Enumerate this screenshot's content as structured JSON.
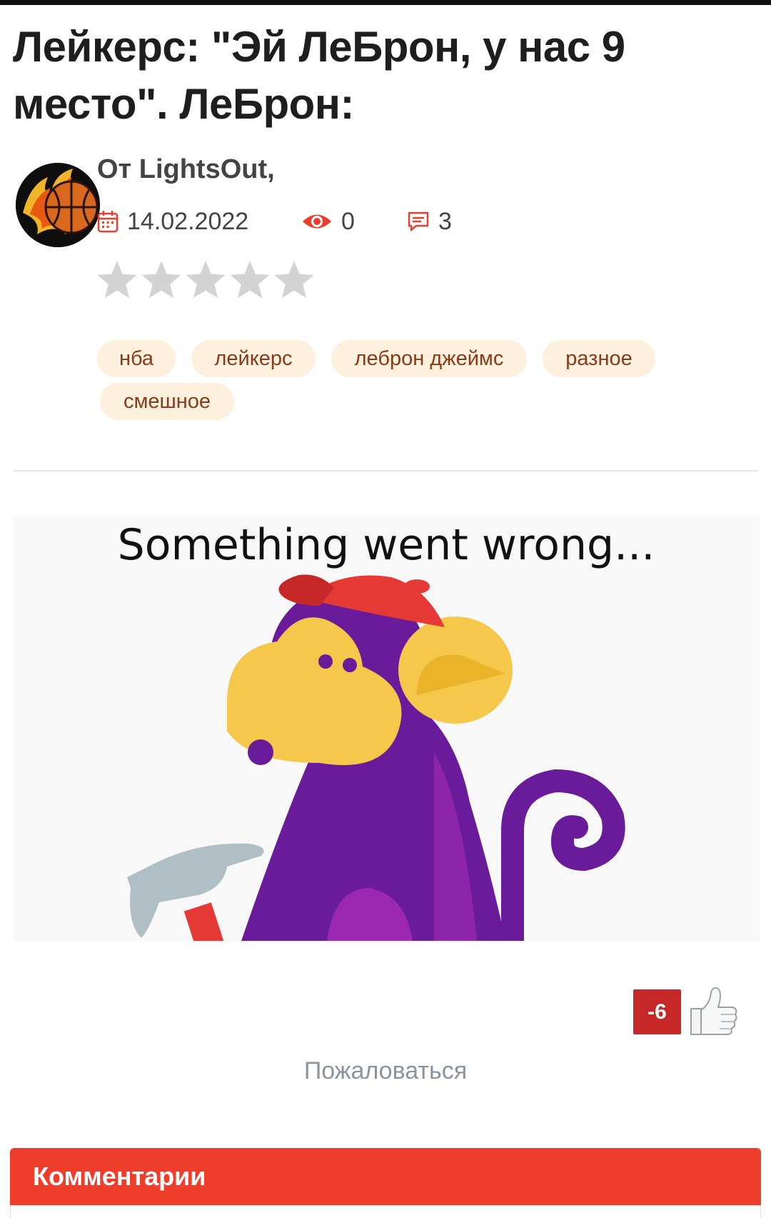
{
  "post": {
    "title": "Лейкерс: \"Эй ЛеБрон, у нас 9 место\". ЛеБрон:",
    "author_line": "От LightsOut,",
    "date": "14.02.2022",
    "views": "0",
    "comments_count": "3",
    "rating_stars_total": 5,
    "rating_stars_filled": 0
  },
  "tags": [
    "нба",
    "лейкерс",
    "леброн джеймс",
    "разное",
    "смешное"
  ],
  "embed": {
    "error_message": "Something went wrong..."
  },
  "vote": {
    "score": "-6"
  },
  "report_label": "Пожаловаться",
  "comments": {
    "header": "Комментарии"
  },
  "icons": {
    "date": "calendar-icon",
    "views": "eye-icon",
    "comments": "comment-icon",
    "like": "thumbs-up-icon",
    "rating": "star-icon"
  },
  "colors": {
    "accent": "#ee3d2b",
    "tag_bg": "#fdf0dd",
    "tag_text": "#8a3a1b",
    "vote_bg": "#c62828",
    "star_inactive": "#d3d3d3"
  }
}
